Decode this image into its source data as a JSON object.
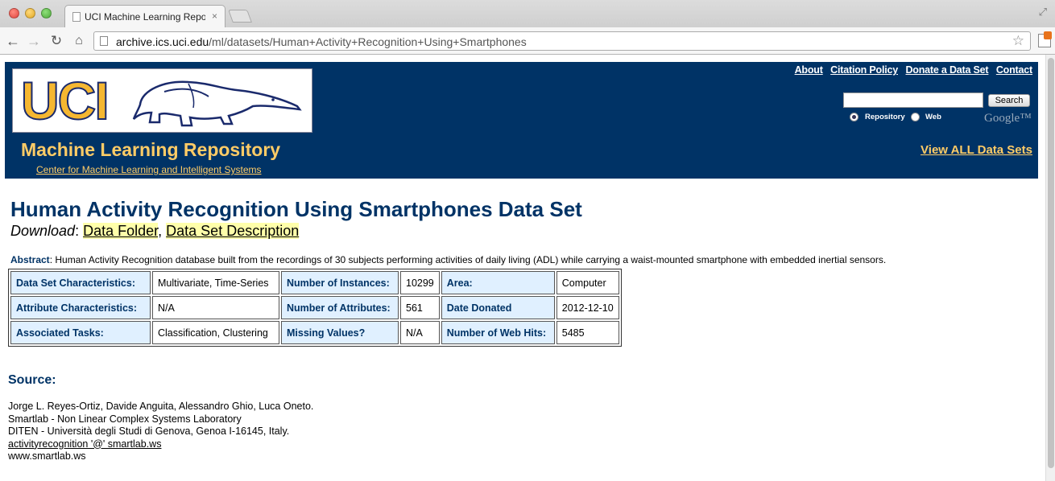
{
  "browser": {
    "tab_title": "UCI Machine Learning Repos",
    "tab_close": "×",
    "url_host": "archive.ics.uci.edu",
    "url_path": "/ml/datasets/Human+Activity+Recognition+Using+Smartphones"
  },
  "header": {
    "logo_text": "UCI",
    "repo_title": "Machine Learning Repository",
    "repo_subtitle": "Center for Machine Learning and Intelligent Systems",
    "links": [
      "About",
      "Citation Policy",
      "Donate a Data Set",
      "Contact"
    ],
    "search_button": "Search",
    "radio_repository": "Repository",
    "radio_web": "Web",
    "google_logo": "Google™",
    "view_all": "View ALL Data Sets"
  },
  "dataset": {
    "title": "Human Activity Recognition Using Smartphones Data Set",
    "download_label": "Download",
    "download_links": [
      "Data Folder",
      "Data Set Description"
    ],
    "abstract_label": "Abstract",
    "abstract_text": "Human Activity Recognition database built from the recordings of 30 subjects performing activities of daily living (ADL) while carrying a waist-mounted smartphone with embedded inertial sensors.",
    "table": [
      [
        "Data Set Characteristics:",
        "Multivariate, Time-Series",
        "Number of Instances:",
        "10299",
        "Area:",
        "Computer"
      ],
      [
        "Attribute Characteristics:",
        "N/A",
        "Number of Attributes:",
        "561",
        "Date Donated",
        "2012-12-10"
      ],
      [
        "Associated Tasks:",
        "Classification, Clustering",
        "Missing Values?",
        "N/A",
        "Number of Web Hits:",
        "5485"
      ]
    ]
  },
  "source": {
    "heading": "Source:",
    "lines": [
      "Jorge L. Reyes-Ortiz, Davide Anguita, Alessandro Ghio, Luca Oneto.",
      "Smartlab - Non Linear Complex Systems Laboratory",
      "DITEN - Università degli Studi di Genova, Genoa I-16145, Italy.",
      "activityrecognition '@' smartlab.ws",
      "www.smartlab.ws"
    ]
  },
  "colors": {
    "header_bg": "#003366",
    "accent_gold": "#ffcc66",
    "table_key_bg": "#e0f0ff",
    "link_highlight": "#ffffaa"
  }
}
